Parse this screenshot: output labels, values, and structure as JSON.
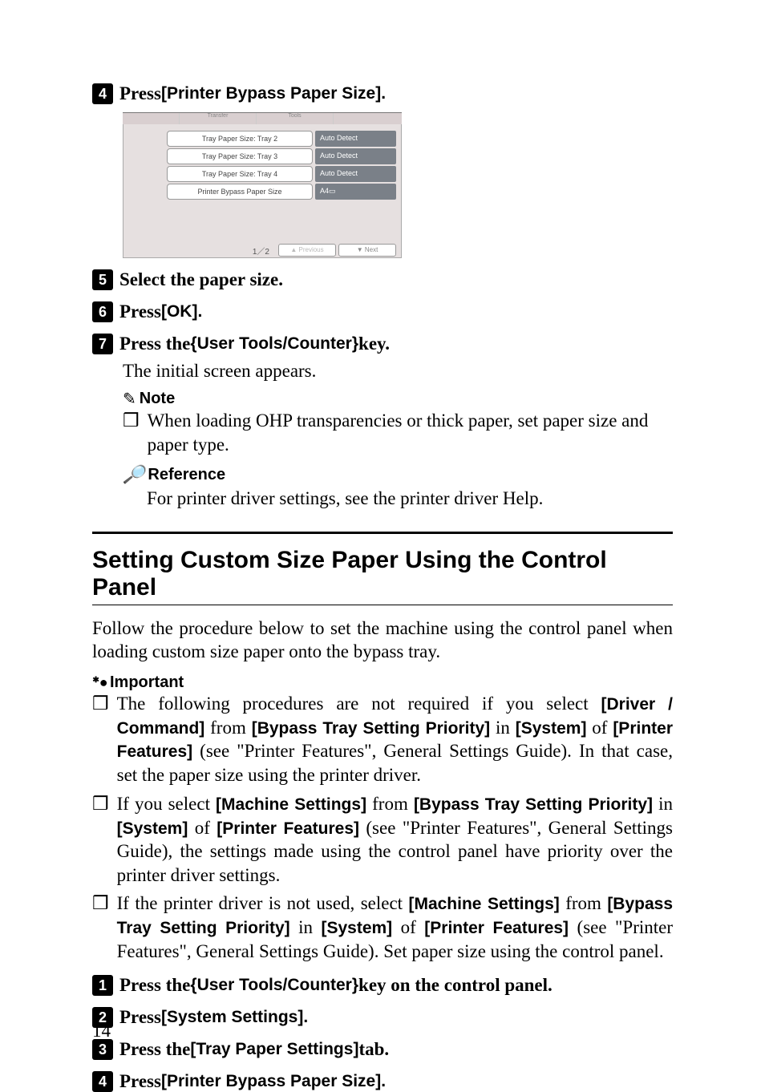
{
  "steps_top": {
    "s4": {
      "num": "4",
      "prefix": "Press ",
      "label": "[Printer Bypass Paper Size]."
    },
    "s5": {
      "num": "5",
      "text": "Select the paper size."
    },
    "s6": {
      "num": "6",
      "prefix": "Press ",
      "label": "[OK]."
    },
    "s7": {
      "num": "7",
      "prefix": "Press the ",
      "keyopen": "{",
      "keylabel": "User Tools/Counter",
      "keyclose": "}",
      "suffix": " key."
    },
    "s7_body": "The initial screen appears."
  },
  "screenshot": {
    "tab_mid": "Transfer",
    "tab_right": "Tools",
    "rows": [
      {
        "label": "Tray Paper Size: Tray 2",
        "value": "Auto Detect"
      },
      {
        "label": "Tray Paper Size: Tray 3",
        "value": "Auto Detect"
      },
      {
        "label": "Tray Paper Size: Tray 4",
        "value": "Auto Detect"
      },
      {
        "label": "Printer Bypass Paper Size",
        "value": "A4▭"
      }
    ],
    "page_counter": "1／2",
    "prev": "▲  Previous",
    "next": "▼    Next"
  },
  "note": {
    "header": "Note",
    "bullet": "When loading OHP transparencies or thick paper, set paper size and paper type."
  },
  "reference": {
    "header": "Reference",
    "text": "For printer driver settings, see the printer driver Help."
  },
  "section": {
    "title": "Setting Custom Size Paper Using the Control Panel",
    "intro": "Follow the procedure below to set the machine using the control panel when loading custom size paper onto the bypass tray."
  },
  "important": {
    "header": "Important",
    "items": [
      {
        "parts": [
          {
            "t": "serif",
            "v": "The following procedures are not required if you select "
          },
          {
            "t": "sans",
            "v": "[Driver / Command]"
          },
          {
            "t": "serif",
            "v": " from "
          },
          {
            "t": "sans",
            "v": "[Bypass Tray Setting Priority]"
          },
          {
            "t": "serif",
            "v": " in "
          },
          {
            "t": "sans",
            "v": "[System]"
          },
          {
            "t": "serif",
            "v": " of "
          },
          {
            "t": "sans",
            "v": "[Printer Features]"
          },
          {
            "t": "serif",
            "v": " (see \"Printer Features\", General Settings Guide). In that case, set the paper size using the printer driver."
          }
        ]
      },
      {
        "parts": [
          {
            "t": "serif",
            "v": "If you select "
          },
          {
            "t": "sans",
            "v": "[Machine Settings]"
          },
          {
            "t": "serif",
            "v": " from "
          },
          {
            "t": "sans",
            "v": "[Bypass Tray Setting Priority]"
          },
          {
            "t": "serif",
            "v": " in "
          },
          {
            "t": "sans",
            "v": "[System]"
          },
          {
            "t": "serif",
            "v": " of "
          },
          {
            "t": "sans",
            "v": "[Printer Features]"
          },
          {
            "t": "serif",
            "v": " (see \"Printer Features\", General Settings Guide), the settings made using the control panel have priority over the printer driver settings."
          }
        ]
      },
      {
        "parts": [
          {
            "t": "serif",
            "v": "If the printer driver is not used, select "
          },
          {
            "t": "sans",
            "v": "[Machine Settings]"
          },
          {
            "t": "serif",
            "v": " from "
          },
          {
            "t": "sans",
            "v": "[Bypass Tray Setting Priority]"
          },
          {
            "t": "serif",
            "v": " in "
          },
          {
            "t": "sans",
            "v": "[System]"
          },
          {
            "t": "serif",
            "v": " of "
          },
          {
            "t": "sans",
            "v": "[Printer Features]"
          },
          {
            "t": "serif",
            "v": " (see \"Printer Features\", General Settings Guide). Set paper size using the control panel."
          }
        ]
      }
    ]
  },
  "steps_bottom": {
    "s1": {
      "num": "1",
      "prefix": "Press the ",
      "keyopen": "{",
      "keylabel": "User Tools/Counter",
      "keyclose": "}",
      "suffix": " key on the control panel."
    },
    "s2": {
      "num": "2",
      "prefix": "Press ",
      "label": "[System Settings]."
    },
    "s3": {
      "num": "3",
      "prefix": "Press the ",
      "label": "[Tray Paper Settings]",
      "suffix": " tab."
    },
    "s4": {
      "num": "4",
      "prefix": "Press ",
      "label": "[Printer Bypass Paper Size]."
    }
  },
  "bullet_symbol": "❒",
  "page_number": "14"
}
